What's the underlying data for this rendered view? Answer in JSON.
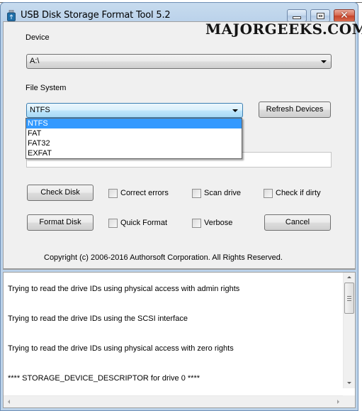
{
  "window": {
    "title": "USB Disk Storage Format Tool 5.2",
    "watermark": "MAJORGEEKS.COM",
    "controls": {
      "minimize": "minimize",
      "maximize": "maximize",
      "close": "✕"
    }
  },
  "device": {
    "label": "Device",
    "selected": "A:\\"
  },
  "file_system": {
    "label": "File System",
    "selected": "NTFS",
    "options": [
      "NTFS",
      "FAT",
      "FAT32",
      "EXFAT"
    ],
    "highlighted_option": "NTFS"
  },
  "volume_label": {
    "value": ""
  },
  "buttons": {
    "refresh": "Refresh Devices",
    "check_disk": "Check Disk",
    "format_disk": "Format Disk",
    "cancel": "Cancel"
  },
  "checkboxes": {
    "correct_errors": {
      "label": "Correct errors",
      "checked": false
    },
    "scan_drive": {
      "label": "Scan drive",
      "checked": false
    },
    "check_if_dirty": {
      "label": "Check if dirty",
      "checked": false
    },
    "quick_format": {
      "label": "Quick Format",
      "checked": false
    },
    "verbose": {
      "label": "Verbose",
      "checked": false
    }
  },
  "copyright": "Copyright (c) 2006-2016 Authorsoft Corporation. All Rights Reserved.",
  "log": {
    "lines": [
      "Trying to read the drive IDs using physical access with admin rights",
      "Trying to read the drive IDs using the SCSI interface",
      "Trying to read the drive IDs using physical access with zero rights",
      "**** STORAGE_DEVICE_DESCRIPTOR for drive 0 ****"
    ]
  }
}
